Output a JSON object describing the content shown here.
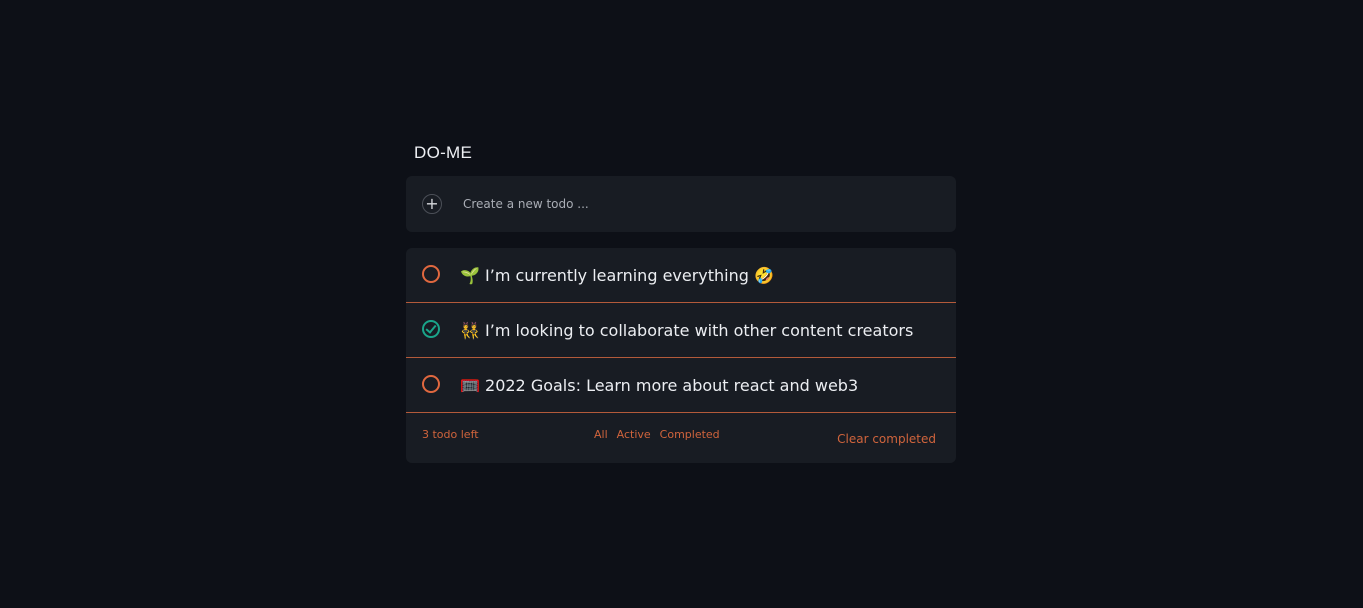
{
  "app": {
    "title": "DO-ME"
  },
  "new_todo": {
    "add_icon_glyph": "+",
    "placeholder": "Create a new todo ..."
  },
  "todos": [
    {
      "text": "🌱 I’m currently learning everything 🤣",
      "completed": false
    },
    {
      "text": "👯 I’m looking to collaborate with other content creators",
      "completed": true
    },
    {
      "text": "🥅 2022 Goals: Learn more about react and web3",
      "completed": false
    }
  ],
  "footer": {
    "count_label": "3 todo left",
    "filters": [
      "All",
      "Active",
      "Completed"
    ],
    "clear_label": "Clear completed"
  },
  "colors": {
    "background": "#0d1017",
    "card": "#181c23",
    "accent": "#e0683f",
    "completed": "#1aa58a"
  }
}
